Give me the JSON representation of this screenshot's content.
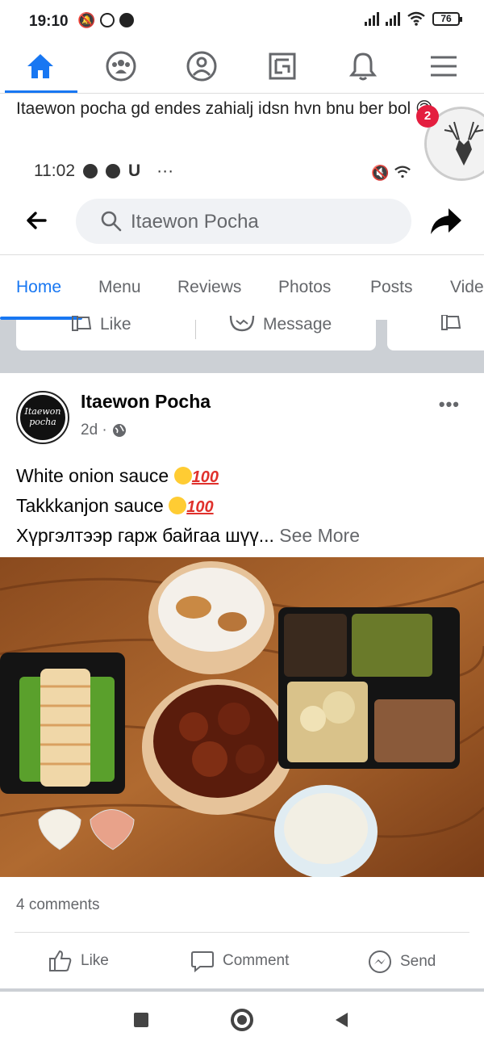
{
  "status_bar": {
    "time": "19:10",
    "battery": "76"
  },
  "notification": {
    "message": "Itaewon pocha  gd endes zahialj idsn hvn bnu ber bol 🙃",
    "time": "11:02",
    "app_letter": "U",
    "ellipsis": "···",
    "chat_badge": "2"
  },
  "search": {
    "query": "Itaewon Pocha"
  },
  "tabs": [
    {
      "label": "Home"
    },
    {
      "label": "Menu"
    },
    {
      "label": "Reviews"
    },
    {
      "label": "Photos"
    },
    {
      "label": "Posts"
    },
    {
      "label": "Vide"
    }
  ],
  "page_actions": {
    "like": "Like",
    "message": "Message"
  },
  "post": {
    "author": "Itaewon Pocha",
    "avatar_text": "Itaewon pocha",
    "time": "2d ·",
    "more": "•••",
    "line1": "White onion sauce ",
    "line2": "Takkkanjon sauce ",
    "hundred": "100",
    "line3": "Хүргэлтээр гарж байгаа шүү... ",
    "see_more": "See More",
    "comments": "4 comments",
    "actions": {
      "like": "Like",
      "comment": "Comment",
      "send": "Send"
    }
  },
  "icons": {
    "accent": "#1877f2"
  }
}
